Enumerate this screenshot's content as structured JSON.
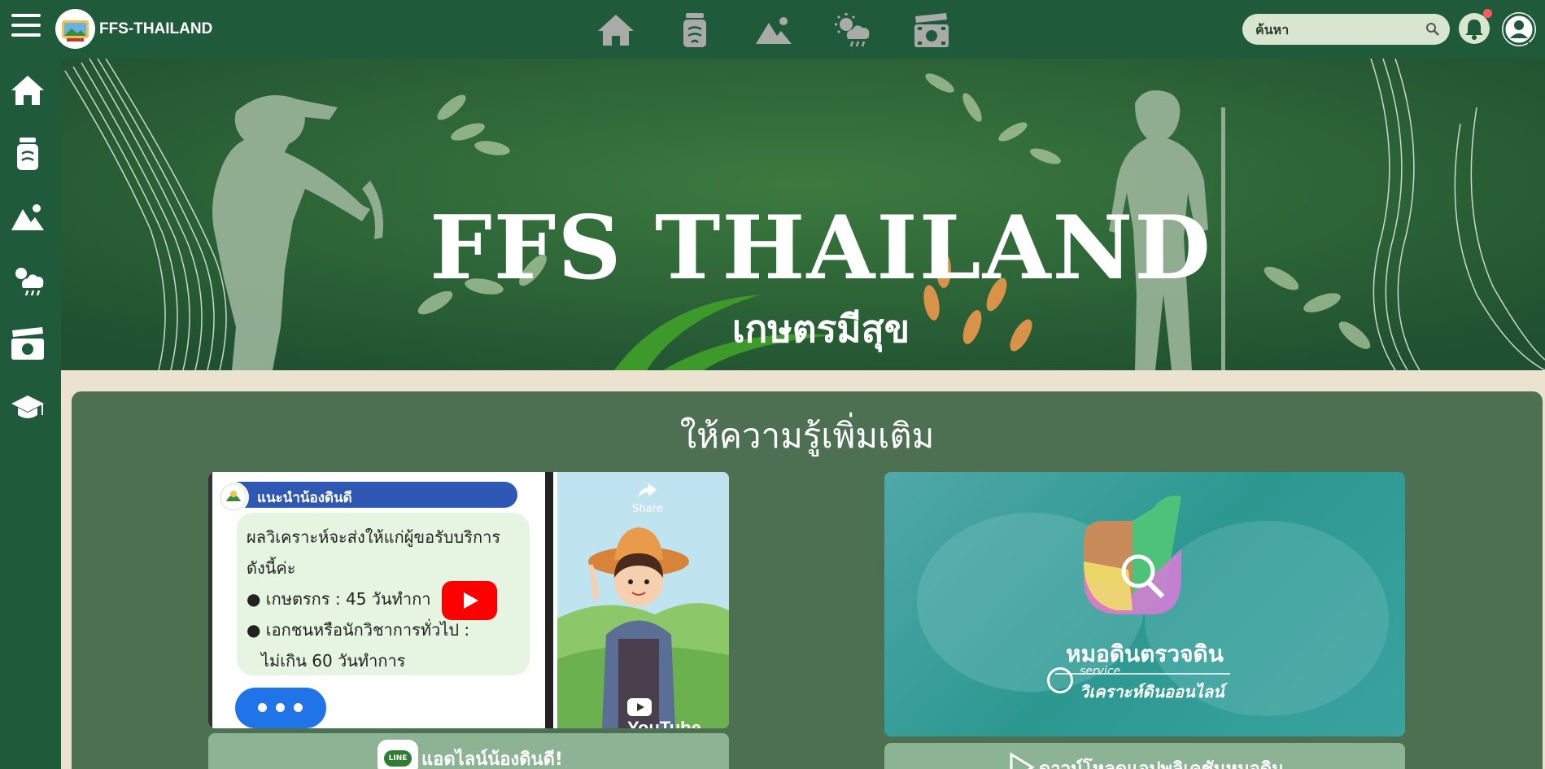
{
  "topbar": {
    "brand": "FFS-THAILAND",
    "nav_icons": [
      "home-icon",
      "soil-bottle-icon",
      "landscape-icon",
      "weather-icon",
      "film-icon"
    ],
    "search": {
      "placeholder": "ค้นหา"
    }
  },
  "sidebar": {
    "items": [
      "home-icon",
      "soil-bottle-icon",
      "landscape-icon",
      "weather-icon",
      "film-icon",
      "graduation-cap-icon"
    ]
  },
  "hero": {
    "title": "FFS THAILAND",
    "subtitle": "เกษตรมีสุข"
  },
  "knowledge": {
    "title": "ให้ความรู้เพิ่มเติม",
    "video": {
      "channel": "แนะนำน้องดินดี",
      "share_label": "Share",
      "lines": [
        "ผลวิเคราะห์จะส่งให้แก่ผู้ขอรับบริการ",
        "ดังนี้ค่ะ",
        "● เกษตรกร : 45 วันทำกา",
        "● เอกชนหรือนักวิชาการทั่วไป :",
        "ไม่เกิน 60 วันทำการ"
      ],
      "platform": "YouTube"
    },
    "line_button": {
      "logo_text": "LINE",
      "label": "แอดไลน์น้องดินดี!"
    },
    "soil_banner": {
      "title": "หมอดินตรวจดิน",
      "service": "service",
      "subtitle": "วิเคราะห์ดินออนไลน์"
    },
    "download_button": {
      "label": "ดาวน์โหลดแอปพลิเคชันหมอดิน"
    }
  },
  "colors": {
    "topbar_bg": "#1f5a3b",
    "panel_bg": "#4d7053",
    "button_bg": "#8cb394",
    "page_bg": "#ebe2cf"
  }
}
